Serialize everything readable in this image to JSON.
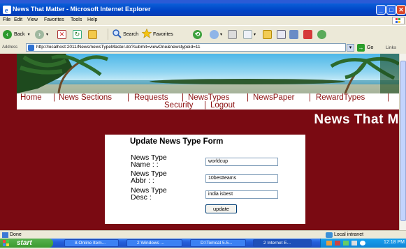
{
  "window": {
    "title": "News That Matter - Microsoft Internet Explorer",
    "controls": {
      "minimize": "_",
      "maximize": "□",
      "close": "✕"
    }
  },
  "menu": [
    "File",
    "Edit",
    "View",
    "Favorites",
    "Tools",
    "Help"
  ],
  "toolbar": {
    "back": "Back",
    "search": "Search",
    "favorites": "Favorites"
  },
  "address": {
    "label": "Address",
    "url": "http://localhost:2011/News/newsTypeMaster.do?submit=viewOne&newstypeid=11",
    "go": "Go",
    "links": "Links"
  },
  "nav": {
    "row1": [
      "Home",
      "News Sections",
      "Requests",
      "NewsTypes",
      "NewsPaper",
      "RewardTypes"
    ],
    "row2": [
      "Security",
      "Logout"
    ],
    "separator": "|"
  },
  "page": {
    "heading": "News That M"
  },
  "form": {
    "title": "Update News Type Form",
    "fields": [
      {
        "label_line1": "News Type",
        "label_line2": "Name : :",
        "value": "worldcup"
      },
      {
        "label_line1": "News Type",
        "label_line2": "Abbr : :",
        "value": "10bestteams"
      },
      {
        "label_line1": "News Type",
        "label_line2": "Desc :",
        "value": "india isbest"
      }
    ],
    "submit": "update"
  },
  "status": {
    "text": "Done",
    "zone": "Local intranet"
  },
  "taskbar": {
    "start": "start",
    "tasks": [
      "8.Online Item...",
      "2 Windows ...",
      "D:\\Tomcat 5.5...",
      "2 Internet E..."
    ],
    "clock": "12:18 PM"
  },
  "colors": {
    "page_background": "#7a0a12",
    "nav_link": "#8b1010",
    "title_bar": "#0042c5"
  }
}
